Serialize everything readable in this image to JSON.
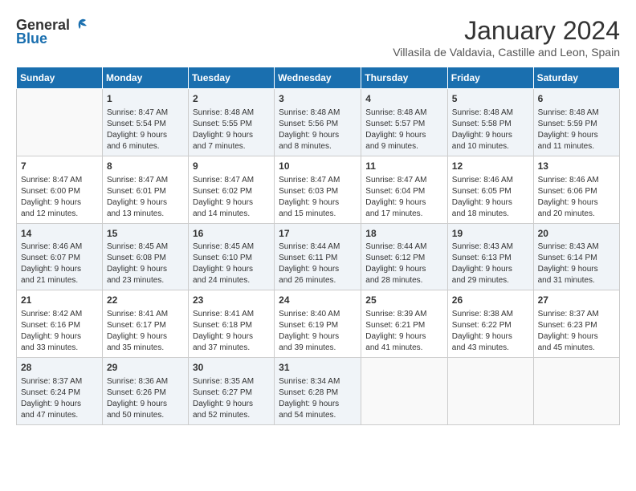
{
  "logo": {
    "general": "General",
    "blue": "Blue"
  },
  "title": "January 2024",
  "subtitle": "Villasila de Valdavia, Castille and Leon, Spain",
  "days_header": [
    "Sunday",
    "Monday",
    "Tuesday",
    "Wednesday",
    "Thursday",
    "Friday",
    "Saturday"
  ],
  "weeks": [
    [
      {
        "day": "",
        "info": ""
      },
      {
        "day": "1",
        "info": "Sunrise: 8:47 AM\nSunset: 5:54 PM\nDaylight: 9 hours\nand 6 minutes."
      },
      {
        "day": "2",
        "info": "Sunrise: 8:48 AM\nSunset: 5:55 PM\nDaylight: 9 hours\nand 7 minutes."
      },
      {
        "day": "3",
        "info": "Sunrise: 8:48 AM\nSunset: 5:56 PM\nDaylight: 9 hours\nand 8 minutes."
      },
      {
        "day": "4",
        "info": "Sunrise: 8:48 AM\nSunset: 5:57 PM\nDaylight: 9 hours\nand 9 minutes."
      },
      {
        "day": "5",
        "info": "Sunrise: 8:48 AM\nSunset: 5:58 PM\nDaylight: 9 hours\nand 10 minutes."
      },
      {
        "day": "6",
        "info": "Sunrise: 8:48 AM\nSunset: 5:59 PM\nDaylight: 9 hours\nand 11 minutes."
      }
    ],
    [
      {
        "day": "7",
        "info": "Sunrise: 8:47 AM\nSunset: 6:00 PM\nDaylight: 9 hours\nand 12 minutes."
      },
      {
        "day": "8",
        "info": "Sunrise: 8:47 AM\nSunset: 6:01 PM\nDaylight: 9 hours\nand 13 minutes."
      },
      {
        "day": "9",
        "info": "Sunrise: 8:47 AM\nSunset: 6:02 PM\nDaylight: 9 hours\nand 14 minutes."
      },
      {
        "day": "10",
        "info": "Sunrise: 8:47 AM\nSunset: 6:03 PM\nDaylight: 9 hours\nand 15 minutes."
      },
      {
        "day": "11",
        "info": "Sunrise: 8:47 AM\nSunset: 6:04 PM\nDaylight: 9 hours\nand 17 minutes."
      },
      {
        "day": "12",
        "info": "Sunrise: 8:46 AM\nSunset: 6:05 PM\nDaylight: 9 hours\nand 18 minutes."
      },
      {
        "day": "13",
        "info": "Sunrise: 8:46 AM\nSunset: 6:06 PM\nDaylight: 9 hours\nand 20 minutes."
      }
    ],
    [
      {
        "day": "14",
        "info": "Sunrise: 8:46 AM\nSunset: 6:07 PM\nDaylight: 9 hours\nand 21 minutes."
      },
      {
        "day": "15",
        "info": "Sunrise: 8:45 AM\nSunset: 6:08 PM\nDaylight: 9 hours\nand 23 minutes."
      },
      {
        "day": "16",
        "info": "Sunrise: 8:45 AM\nSunset: 6:10 PM\nDaylight: 9 hours\nand 24 minutes."
      },
      {
        "day": "17",
        "info": "Sunrise: 8:44 AM\nSunset: 6:11 PM\nDaylight: 9 hours\nand 26 minutes."
      },
      {
        "day": "18",
        "info": "Sunrise: 8:44 AM\nSunset: 6:12 PM\nDaylight: 9 hours\nand 28 minutes."
      },
      {
        "day": "19",
        "info": "Sunrise: 8:43 AM\nSunset: 6:13 PM\nDaylight: 9 hours\nand 29 minutes."
      },
      {
        "day": "20",
        "info": "Sunrise: 8:43 AM\nSunset: 6:14 PM\nDaylight: 9 hours\nand 31 minutes."
      }
    ],
    [
      {
        "day": "21",
        "info": "Sunrise: 8:42 AM\nSunset: 6:16 PM\nDaylight: 9 hours\nand 33 minutes."
      },
      {
        "day": "22",
        "info": "Sunrise: 8:41 AM\nSunset: 6:17 PM\nDaylight: 9 hours\nand 35 minutes."
      },
      {
        "day": "23",
        "info": "Sunrise: 8:41 AM\nSunset: 6:18 PM\nDaylight: 9 hours\nand 37 minutes."
      },
      {
        "day": "24",
        "info": "Sunrise: 8:40 AM\nSunset: 6:19 PM\nDaylight: 9 hours\nand 39 minutes."
      },
      {
        "day": "25",
        "info": "Sunrise: 8:39 AM\nSunset: 6:21 PM\nDaylight: 9 hours\nand 41 minutes."
      },
      {
        "day": "26",
        "info": "Sunrise: 8:38 AM\nSunset: 6:22 PM\nDaylight: 9 hours\nand 43 minutes."
      },
      {
        "day": "27",
        "info": "Sunrise: 8:37 AM\nSunset: 6:23 PM\nDaylight: 9 hours\nand 45 minutes."
      }
    ],
    [
      {
        "day": "28",
        "info": "Sunrise: 8:37 AM\nSunset: 6:24 PM\nDaylight: 9 hours\nand 47 minutes."
      },
      {
        "day": "29",
        "info": "Sunrise: 8:36 AM\nSunset: 6:26 PM\nDaylight: 9 hours\nand 50 minutes."
      },
      {
        "day": "30",
        "info": "Sunrise: 8:35 AM\nSunset: 6:27 PM\nDaylight: 9 hours\nand 52 minutes."
      },
      {
        "day": "31",
        "info": "Sunrise: 8:34 AM\nSunset: 6:28 PM\nDaylight: 9 hours\nand 54 minutes."
      },
      {
        "day": "",
        "info": ""
      },
      {
        "day": "",
        "info": ""
      },
      {
        "day": "",
        "info": ""
      }
    ]
  ]
}
